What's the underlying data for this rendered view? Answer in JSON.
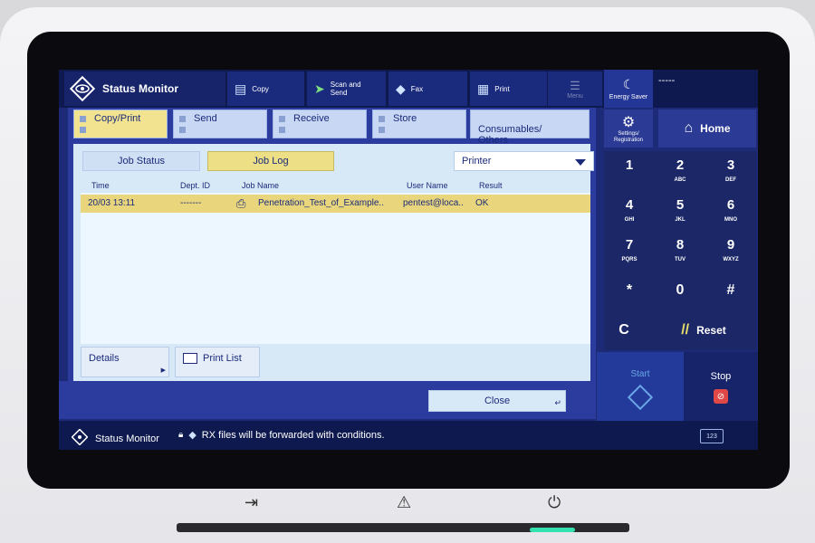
{
  "header": {
    "app_title": "Status Monitor",
    "functions": [
      {
        "label": "Copy",
        "icon": "copy-icon"
      },
      {
        "label": "Scan and Send",
        "icon": "scan-send-icon"
      },
      {
        "label": "Fax",
        "icon": "fax-icon"
      },
      {
        "label": "Print",
        "icon": "print-icon"
      }
    ],
    "menu_label": "Menu",
    "energy_saver": "Energy Saver",
    "user_placeholder": "-----"
  },
  "categories": [
    {
      "label": "Copy/Print",
      "active": true
    },
    {
      "label": "Send",
      "active": false
    },
    {
      "label": "Receive",
      "active": false
    },
    {
      "label": "Store",
      "active": false
    },
    {
      "label": "Consumables/\nOthers",
      "active": false
    }
  ],
  "tabs": {
    "job_status": "Job Status",
    "job_log": "Job Log",
    "selected": "Job Log"
  },
  "device_select": {
    "value": "Printer"
  },
  "table": {
    "columns": [
      "Time",
      "Dept. ID",
      "Job Name",
      "User Name",
      "Result"
    ],
    "rows": [
      {
        "time": "20/03 13:11",
        "dept": "-------",
        "job": "Penetration_Test_of_Example..",
        "user": "pentest@loca..",
        "result": "OK"
      }
    ]
  },
  "buttons": {
    "details": "Details",
    "print_list": "Print List",
    "close": "Close"
  },
  "right_panel": {
    "settings": "Settings/\nRegistration",
    "home": "Home",
    "keys": [
      {
        "n": "1",
        "s": ""
      },
      {
        "n": "2",
        "s": "ABC"
      },
      {
        "n": "3",
        "s": "DEF"
      },
      {
        "n": "4",
        "s": "GHI"
      },
      {
        "n": "5",
        "s": "JKL"
      },
      {
        "n": "6",
        "s": "MNO"
      },
      {
        "n": "7",
        "s": "PQRS"
      },
      {
        "n": "8",
        "s": "TUV"
      },
      {
        "n": "9",
        "s": "WXYZ"
      },
      {
        "n": "*",
        "s": ""
      },
      {
        "n": "0",
        "s": ""
      },
      {
        "n": "#",
        "s": ""
      }
    ],
    "clear": "C",
    "reset": "Reset",
    "start": "Start",
    "stop": "Stop"
  },
  "statusbar": {
    "title": "Status Monitor",
    "message": "RX files will be forwarded with conditions.",
    "keyboard_label": "123"
  },
  "colors": {
    "accent": "#2c3c9e",
    "highlight": "#e9d67c",
    "stop": "#e04848"
  }
}
